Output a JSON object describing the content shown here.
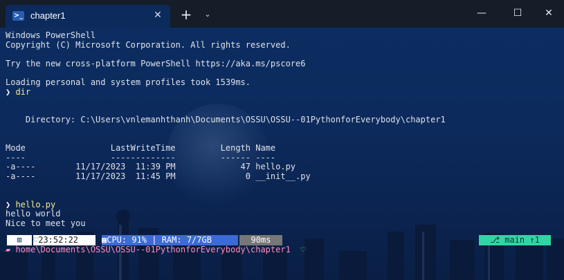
{
  "tab": {
    "title": "chapter1",
    "icon": "powershell-icon"
  },
  "window_controls": {
    "new_tab": "+",
    "dropdown": "⌄",
    "minimize": "—",
    "maximize": "☐",
    "close": "✕"
  },
  "terminal": {
    "lines": [
      "Windows PowerShell",
      "Copyright (C) Microsoft Corporation. All rights reserved.",
      "",
      "Try the new cross-platform PowerShell https://aka.ms/pscore6",
      "",
      "Loading personal and system profiles took 1539ms."
    ],
    "command1": "dir",
    "dir_output": [
      "",
      "",
      "    Directory: C:\\Users\\vnlemanhthanh\\Documents\\OSSU\\OSSU--01PythonforEverybody\\chapter1",
      "",
      "",
      "Mode                 LastWriteTime         Length Name",
      "----                 -------------         ------ ----",
      "-a----        11/17/2023  11:39 PM             47 hello.py",
      "-a----        11/17/2023  11:45 PM              0 __init__.py",
      "",
      ""
    ],
    "command2": "hello.py",
    "program_output": [
      "hello world",
      "Nice to meet you"
    ]
  },
  "status": {
    "time": "♡23:52:22",
    "resources": "▦CPU: 91% | RAM: 7/7GB",
    "duration": "90ms",
    "git": "⎇ main ↑1",
    "path": "home\\Documents\\OSSU\\OSSU--01PythonforEverybody\\chapter1",
    "heart": "♡"
  }
}
